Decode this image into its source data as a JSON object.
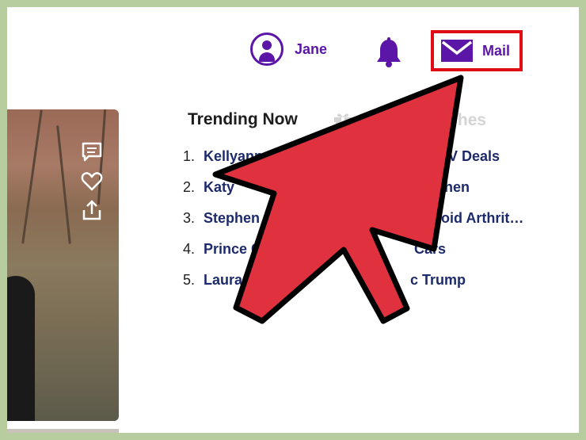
{
  "header": {
    "user_name": "Jane",
    "mail_label": "Mail"
  },
  "trending": {
    "tab_active": "Trending Now",
    "tab_inactive": "Latest Searches",
    "left_items": [
      {
        "num": "1.",
        "text": "Kellyanne C"
      },
      {
        "num": "2.",
        "text": "Katy"
      },
      {
        "num": "3.",
        "text": "Stephen Curr"
      },
      {
        "num": "4.",
        "text": "Prince Ch"
      },
      {
        "num": "5.",
        "text": "Laura"
      }
    ],
    "right_items": [
      {
        "text": "SUV Deals"
      },
      {
        "text": "Cohen"
      },
      {
        "text": "umatoid Arthrit…"
      },
      {
        "text": "Cars"
      },
      {
        "text": "c Trump"
      }
    ]
  },
  "colors": {
    "brand_purple": "#5b16a8",
    "highlight_red": "#e10d14",
    "arrow_red": "#e0313e"
  }
}
